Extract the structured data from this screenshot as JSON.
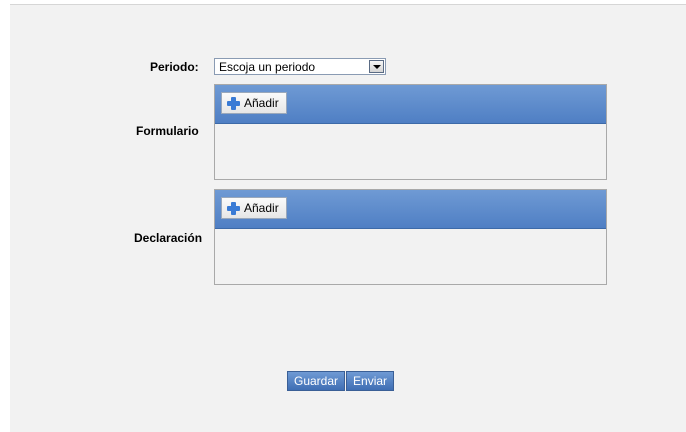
{
  "form": {
    "period_label": "Periodo:",
    "period_select": {
      "selected": "Escoja un periodo"
    },
    "formulario_label": "Formulario",
    "declaracion_label": "Declaración",
    "formulario_add": "Añadir",
    "declaracion_add": "Añadir"
  },
  "actions": {
    "save": "Guardar",
    "send": "Enviar"
  }
}
